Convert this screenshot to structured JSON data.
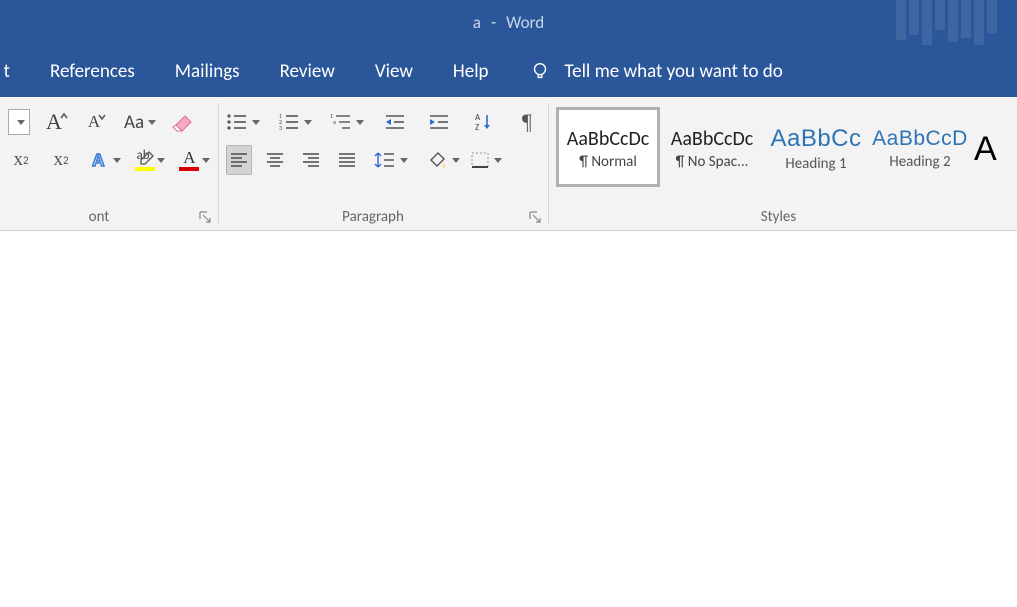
{
  "titlebar": {
    "doc": "a",
    "sep": "-",
    "app": "Word"
  },
  "tabs": {
    "partial": "t",
    "items": [
      "References",
      "Mailings",
      "Review",
      "View",
      "Help"
    ],
    "tellme": "Tell me what you want to do"
  },
  "font": {
    "group_label": "ont",
    "increaseA": "A",
    "decreaseA": "A",
    "changecase": "Aa",
    "sub_x": "x",
    "sub_2": "2",
    "sup_x": "x",
    "sup_2": "2",
    "texteffects": "A",
    "highlight_pen": "ab",
    "fontcolorA": "A"
  },
  "paragraph": {
    "group_label": "Paragraph",
    "sortAZ_top": "A",
    "sortAZ_bot": "Z",
    "pilcrow": "¶",
    "num1": "1",
    "num2": "2",
    "num3": "3",
    "mln1": "1",
    "mlna": "a"
  },
  "styles": {
    "group_label": "Styles",
    "tiles": [
      {
        "sample": "AaBbCcDc",
        "name": "¶ Normal",
        "selected": true,
        "kind": "body"
      },
      {
        "sample": "AaBbCcDc",
        "name": "¶ No Spac...",
        "kind": "body"
      },
      {
        "sample": "AaBbCc",
        "name": "Heading 1",
        "kind": "heading"
      },
      {
        "sample": "AaBbCcD",
        "name": "Heading 2",
        "kind": "heading"
      },
      {
        "sample": "A",
        "name": "",
        "kind": "title"
      }
    ]
  }
}
